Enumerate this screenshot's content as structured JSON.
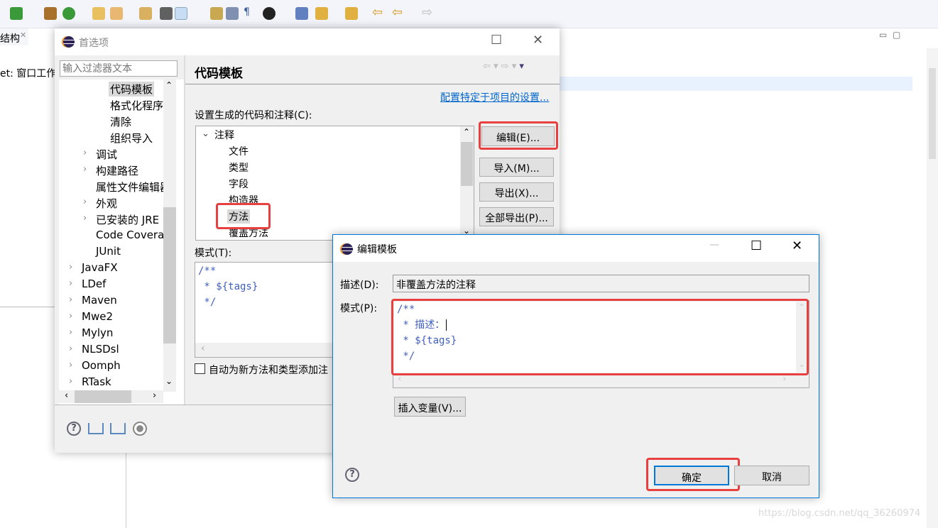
{
  "ide": {
    "panel_tab": "结构",
    "panel_line": "et: 窗口工作"
  },
  "prefs": {
    "title": "首选项",
    "filter_placeholder": "输入过滤器文本",
    "tree": [
      {
        "label": "代码模板",
        "selected": true
      },
      {
        "label": "格式化程序"
      },
      {
        "label": "清除"
      },
      {
        "label": "组织导入"
      },
      {
        "label": "调试",
        "expandable": true
      },
      {
        "label": "构建路径",
        "expandable": true
      },
      {
        "label": "属性文件编辑器"
      },
      {
        "label": "外观",
        "expandable": true
      },
      {
        "label": "已安装的 JRE",
        "expandable": true
      },
      {
        "label": "Code Coverag"
      },
      {
        "label": "JUnit"
      },
      {
        "label": "JavaFX",
        "expandable": true
      },
      {
        "label": "LDef",
        "expandable": true
      },
      {
        "label": "Maven",
        "expandable": true
      },
      {
        "label": "Mwe2",
        "expandable": true
      },
      {
        "label": "Mylyn",
        "expandable": true
      },
      {
        "label": "NLSDsl",
        "expandable": true
      },
      {
        "label": "Oomph",
        "expandable": true
      },
      {
        "label": "RTask",
        "expandable": true
      }
    ],
    "page_title": "代码模板",
    "project_link": "配置特定于项目的设置...",
    "list_label": "设置生成的代码和注释(C):",
    "code_tree": {
      "group": "注释",
      "items": [
        "文件",
        "类型",
        "字段",
        "构造器",
        "方法",
        "覆盖方法"
      ],
      "selected": "方法"
    },
    "buttons": {
      "edit": "编辑(E)...",
      "import": "导入(M)...",
      "export": "导出(X)...",
      "export_all": "全部导出(P)..."
    },
    "pattern_label": "模式(T):",
    "pattern_lines": [
      "/**",
      " * ${tags}",
      " */"
    ],
    "auto_add_label": "自动为新方法和类型添加注"
  },
  "edit": {
    "title": "编辑模板",
    "desc_label": "描述(D):",
    "desc_value": "非覆盖方法的注释",
    "pattern_label": "模式(P):",
    "pattern_lines": [
      "/**",
      " * 描述：",
      " * ${tags}",
      " */"
    ],
    "insert_var": "插入变量(V)...",
    "ok": "确定",
    "cancel": "取消"
  },
  "watermark": "https://blog.csdn.net/qq_36260974",
  "colors": {
    "highlight": "#e8403f",
    "link": "#0066cc",
    "code": "#3f5fbf",
    "focus": "#0078d7"
  }
}
